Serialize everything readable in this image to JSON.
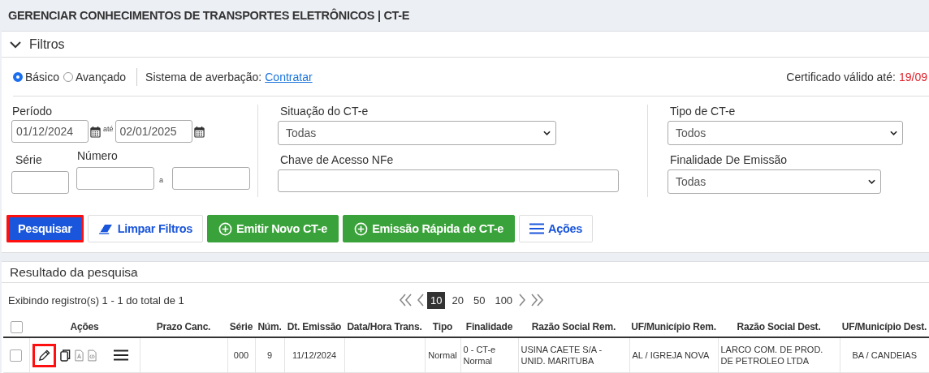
{
  "page_title": "GERENCIAR CONHECIMENTOS DE TRANSPORTES ELETRÔNICOS | CT-E",
  "filters": {
    "title": "Filtros",
    "expanded": true,
    "modes": [
      {
        "label": "Básico",
        "selected": true
      },
      {
        "label": "Avançado",
        "selected": false
      }
    ],
    "insurance_label": "Sistema de averbação:",
    "insurance_link": "Contratar",
    "certificate_label": "Certificado válido até:",
    "certificate_date": "19/09",
    "period": {
      "label": "Período",
      "from": "01/12/2024",
      "separator": "até",
      "to": "02/01/2025"
    },
    "series": {
      "label": "Série"
    },
    "number": {
      "label": "Número",
      "separator": "a"
    },
    "status": {
      "label": "Situação do CT-e",
      "value": "Todas"
    },
    "nfe_key": {
      "label": "Chave de Acesso NFe"
    },
    "cte_type": {
      "label": "Tipo de CT-e",
      "value": "Todos"
    },
    "purpose": {
      "label": "Finalidade De Emissão",
      "value": "Todas"
    }
  },
  "buttons": [
    {
      "label": "Pesquisar",
      "kind": "primary",
      "highlighted": true
    },
    {
      "label": "Limpar Filtros",
      "kind": "eraser",
      "highlighted": false
    },
    {
      "label": "Emitir Novo CT-e",
      "kind": "add",
      "highlighted": false
    },
    {
      "label": "Emissão Rápida de CT-e",
      "kind": "add",
      "highlighted": false
    },
    {
      "label": "Ações",
      "kind": "menu",
      "highlighted": false
    }
  ],
  "results": {
    "title": "Resultado da pesquisa",
    "summary": "Exibindo registro(s) 1 - 1 do total de 1",
    "page_sizes": [
      {
        "label": "10",
        "selected": true
      },
      {
        "label": "20",
        "selected": false
      },
      {
        "label": "50",
        "selected": false
      },
      {
        "label": "100",
        "selected": false
      }
    ],
    "columns": [
      "Ações",
      "Prazo Canc.",
      "Série",
      "Núm.",
      "Dt. Emissão",
      "Data/Hora Trans.",
      "Tipo",
      "Finalidade",
      "Razão Social Rem.",
      "UF/Município Rem.",
      "Razão Social Dest.",
      "UF/Município Dest."
    ],
    "all_checked": false,
    "rows": [
      {
        "checked": false,
        "actions": [
          {
            "kind": "edit",
            "highlighted": true
          },
          {
            "kind": "copy",
            "highlighted": false
          },
          {
            "kind": "pdf",
            "highlighted": false
          },
          {
            "kind": "xml",
            "highlighted": false
          },
          {
            "kind": "menu",
            "highlighted": false
          }
        ],
        "cells": [
          "",
          "",
          "000",
          "9",
          "11/12/2024",
          "",
          "Normal",
          "0 - CT-e Normal",
          "USINA CAETE S/A - UNID. MARITUBA",
          "AL / IGREJA NOVA",
          "LARCO COM. DE PROD. DE PETROLEO LTDA",
          "BA / CANDEIAS"
        ]
      }
    ]
  }
}
